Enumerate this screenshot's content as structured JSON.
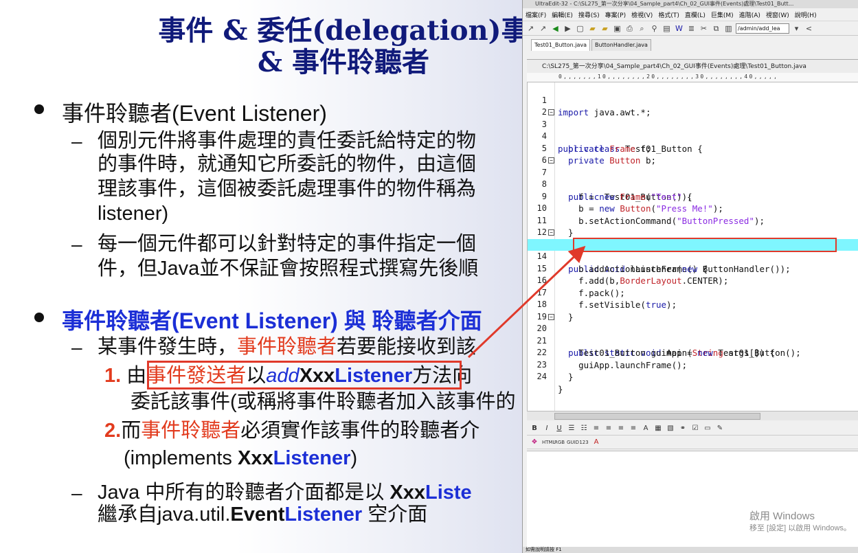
{
  "slide": {
    "title_line1": "事件 & 委任(delegation)事",
    "title_line2": "& 事件聆聽者",
    "bullet1": "事件聆聽者(Event Listener)",
    "b1_dash1_l1": "個別元件將事件處理的責任委託給特定的物",
    "b1_dash1_l2": "的事件時，就通知它所委託的物件，由這個",
    "b1_dash1_l3": "理該事件，這個被委託處理事件的物件稱為",
    "b1_dash1_l4": "listener)",
    "b1_dash2_l1": "每一個元件都可以針對特定的事件指定一個",
    "b1_dash2_l2": "件，但Java並不保証會按照程式撰寫先後順",
    "bullet2": "事件聆聽者(Event Listener) 與 聆聽者介面",
    "b2_dash1_a": "某事件發生時，",
    "b2_dash1_b": "事件聆聽者",
    "b2_dash1_c": "若要能接收到該",
    "item1_num": "1.",
    "item1_a": "由",
    "item1_b": "事件發送者",
    "item1_c": "以",
    "item1_d": "add",
    "item1_e": "Xxx",
    "item1_f": "Listener",
    "item1_g": "方法向",
    "item1_l2": "委託該事件(或稱將事件聆聽者加入該事件的",
    "item2_num": "2.",
    "item2_a": "而",
    "item2_b": "事件聆聽者",
    "item2_c": "必須實作該事件的聆聽者介",
    "item2_l2_a": "(implements ",
    "item2_l2_b": "Xxx",
    "item2_l2_c": "Listener",
    "item2_l2_d": ")",
    "b2_dash2_a": "Java 中所有的聆聽者介面都是以 ",
    "b2_dash2_b": "Xxx",
    "b2_dash2_c": "Liste",
    "b2_dash2_l2_a": "繼承自java.util.",
    "b2_dash2_l2_b": "Event",
    "b2_dash2_l2_c": "Listener",
    "b2_dash2_l2_d": " 空介面"
  },
  "editor": {
    "title": "UltraEdit-32 - C:\\SL275_第一次分享\\04_Sample_part4\\Ch_02_GUI事件(Events)處理\\Test01_Butt...",
    "menu": [
      "檔案(F)",
      "編輯(E)",
      "搜尋(S)",
      "專案(P)",
      "檢視(V)",
      "格式(T)",
      "直欄(L)",
      "巨集(M)",
      "進階(A)",
      "視窗(W)",
      "說明(H)"
    ],
    "toolbar_combo": "/admin/add_lea",
    "tabs": [
      "Test01_Button.java",
      "ButtonHandler.java"
    ],
    "file_path": "C:\\SL275_第一次分享\\04_Sample_part4\\Ch_02_GUI事件(Events)處理\\Test01_Button.java",
    "ruler": "0,,,,,,,10,,,,,,,,20,,,,,,,,30,,,,,,,,40,,,,,",
    "lines": [
      {
        "n": "1",
        "text": "import java.awt.*;"
      },
      {
        "n": "2",
        "text": ""
      },
      {
        "n": "3",
        "text": "public class Test01_Button {"
      },
      {
        "n": "4",
        "text": "  private Frame f;"
      },
      {
        "n": "5",
        "text": "  private Button b;"
      },
      {
        "n": "6",
        "text": ""
      },
      {
        "n": "7",
        "text": "  public Test01_Button() {"
      },
      {
        "n": "8",
        "text": "    f = new Frame(\"Test\");"
      },
      {
        "n": "9",
        "text": "    b = new Button(\"Press Me!\");"
      },
      {
        "n": "10",
        "text": "    b.setActionCommand(\"ButtonPressed\");"
      },
      {
        "n": "11",
        "text": "  }"
      },
      {
        "n": "12",
        "text": ""
      },
      {
        "n": "13",
        "text": "  public void launchFrame() {"
      },
      {
        "n": "14",
        "text": "    b.addActionListener(new ButtonHandler());"
      },
      {
        "n": "15",
        "text": "    f.add(b,BorderLayout.CENTER);"
      },
      {
        "n": "16",
        "text": "    f.pack();"
      },
      {
        "n": "17",
        "text": "    f.setVisible(true);"
      },
      {
        "n": "18",
        "text": "  }"
      },
      {
        "n": "19",
        "text": ""
      },
      {
        "n": "20",
        "text": "  public static void main(String args[]) {"
      },
      {
        "n": "21",
        "text": "    Test01_Button guiApp = new Test01_Button();"
      },
      {
        "n": "22",
        "text": "    guiApp.launchFrame();"
      },
      {
        "n": "23",
        "text": "  }"
      },
      {
        "n": "24",
        "text": "}"
      }
    ],
    "watermark_line1": "啟用 Windows",
    "watermark_line2": "移至 [設定] 以啟用 Windows。",
    "status": "如需說明請按 F1"
  },
  "colors": {
    "title_blue": "#101a7a",
    "blue": "#1c2fd6",
    "red": "#e23b1e",
    "box_red": "#e0392a",
    "keyword": "#1a1aa8",
    "type": "#c0242a",
    "string": "#8a2be2",
    "highlight": "#7ff6ff"
  }
}
